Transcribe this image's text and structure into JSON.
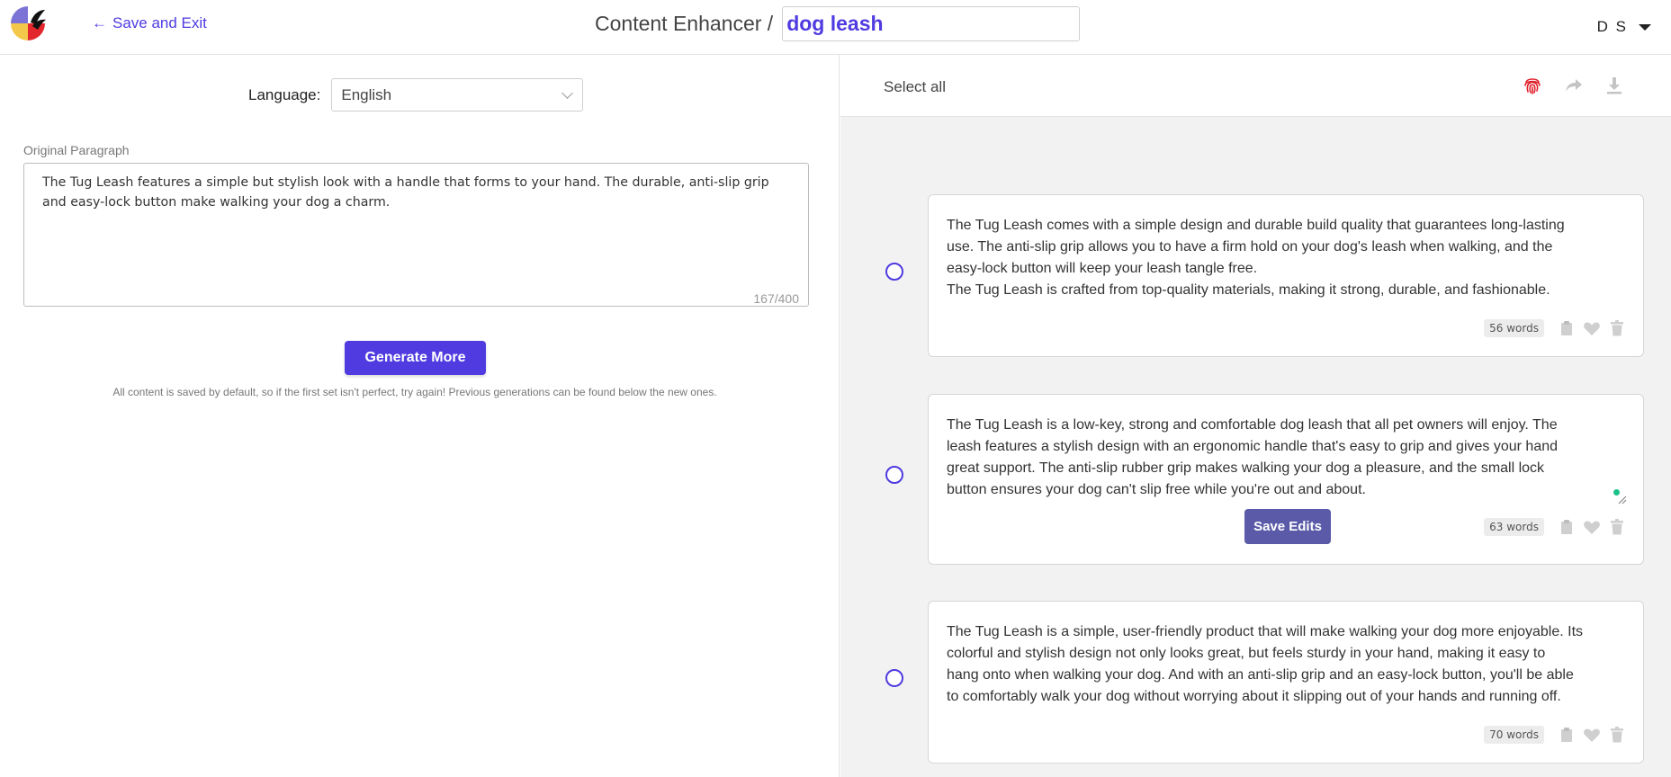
{
  "header": {
    "back_label": "Save and Exit",
    "back_arrow": "←",
    "title": "Content Enhancer /",
    "project_name": "dog leash",
    "user_initials": "D S"
  },
  "left": {
    "language_label": "Language:",
    "language_value": "English",
    "original_label": "Original Paragraph",
    "original_text": "The Tug Leash features a simple but stylish look with a handle that forms to your hand. The durable, anti-slip grip and easy-lock button make walking your dog a charm.",
    "counter": "167/400",
    "generate_label": "Generate More",
    "hint": "All content is saved by default, so if the first set isn't perfect, try again! Previous generations can be found below the new ones."
  },
  "right": {
    "select_all": "Select all",
    "icons": [
      "fingerprint-icon",
      "share-icon",
      "download-icon"
    ],
    "cards": [
      {
        "lines": [
          "The Tug Leash comes with a simple design and durable build quality that guarantees long-lasting",
          "use. The anti-slip grip allows you to have a firm hold on your dog's leash when walking, and the",
          "easy-lock button will keep your leash tangle free.",
          "The Tug Leash is crafted from top-quality materials, making it strong, durable, and fashionable."
        ],
        "words": "56 words"
      },
      {
        "lines": [
          "The Tug Leash is a low-key, strong and comfortable dog leash that all pet owners will enjoy. The",
          "leash features a stylish design with an ergonomic handle that's easy to grip and gives your hand",
          "great support. The anti-slip rubber grip makes walking your dog a pleasure, and the small lock",
          "button ensures your dog can't slip free while you're out and about."
        ],
        "words": "63 words",
        "save_label": "Save Edits"
      },
      {
        "lines": [
          "The Tug Leash is a simple, user-friendly product that will make walking your dog more enjoyable. Its",
          "colorful and stylish design not only looks great, but feels sturdy in your hand, making it easy to",
          "hang onto when walking your dog. And with an anti-slip grip and an easy-lock button, you'll be able",
          "to comfortably walk your dog without worrying about it slipping out of your hands and running off."
        ],
        "words": "70 words"
      }
    ]
  },
  "colors": {
    "accent": "#4f3be0",
    "save_button": "#5a5aa8",
    "fingerprint": "#e0202a",
    "pane_bg": "#f2f2f2"
  }
}
